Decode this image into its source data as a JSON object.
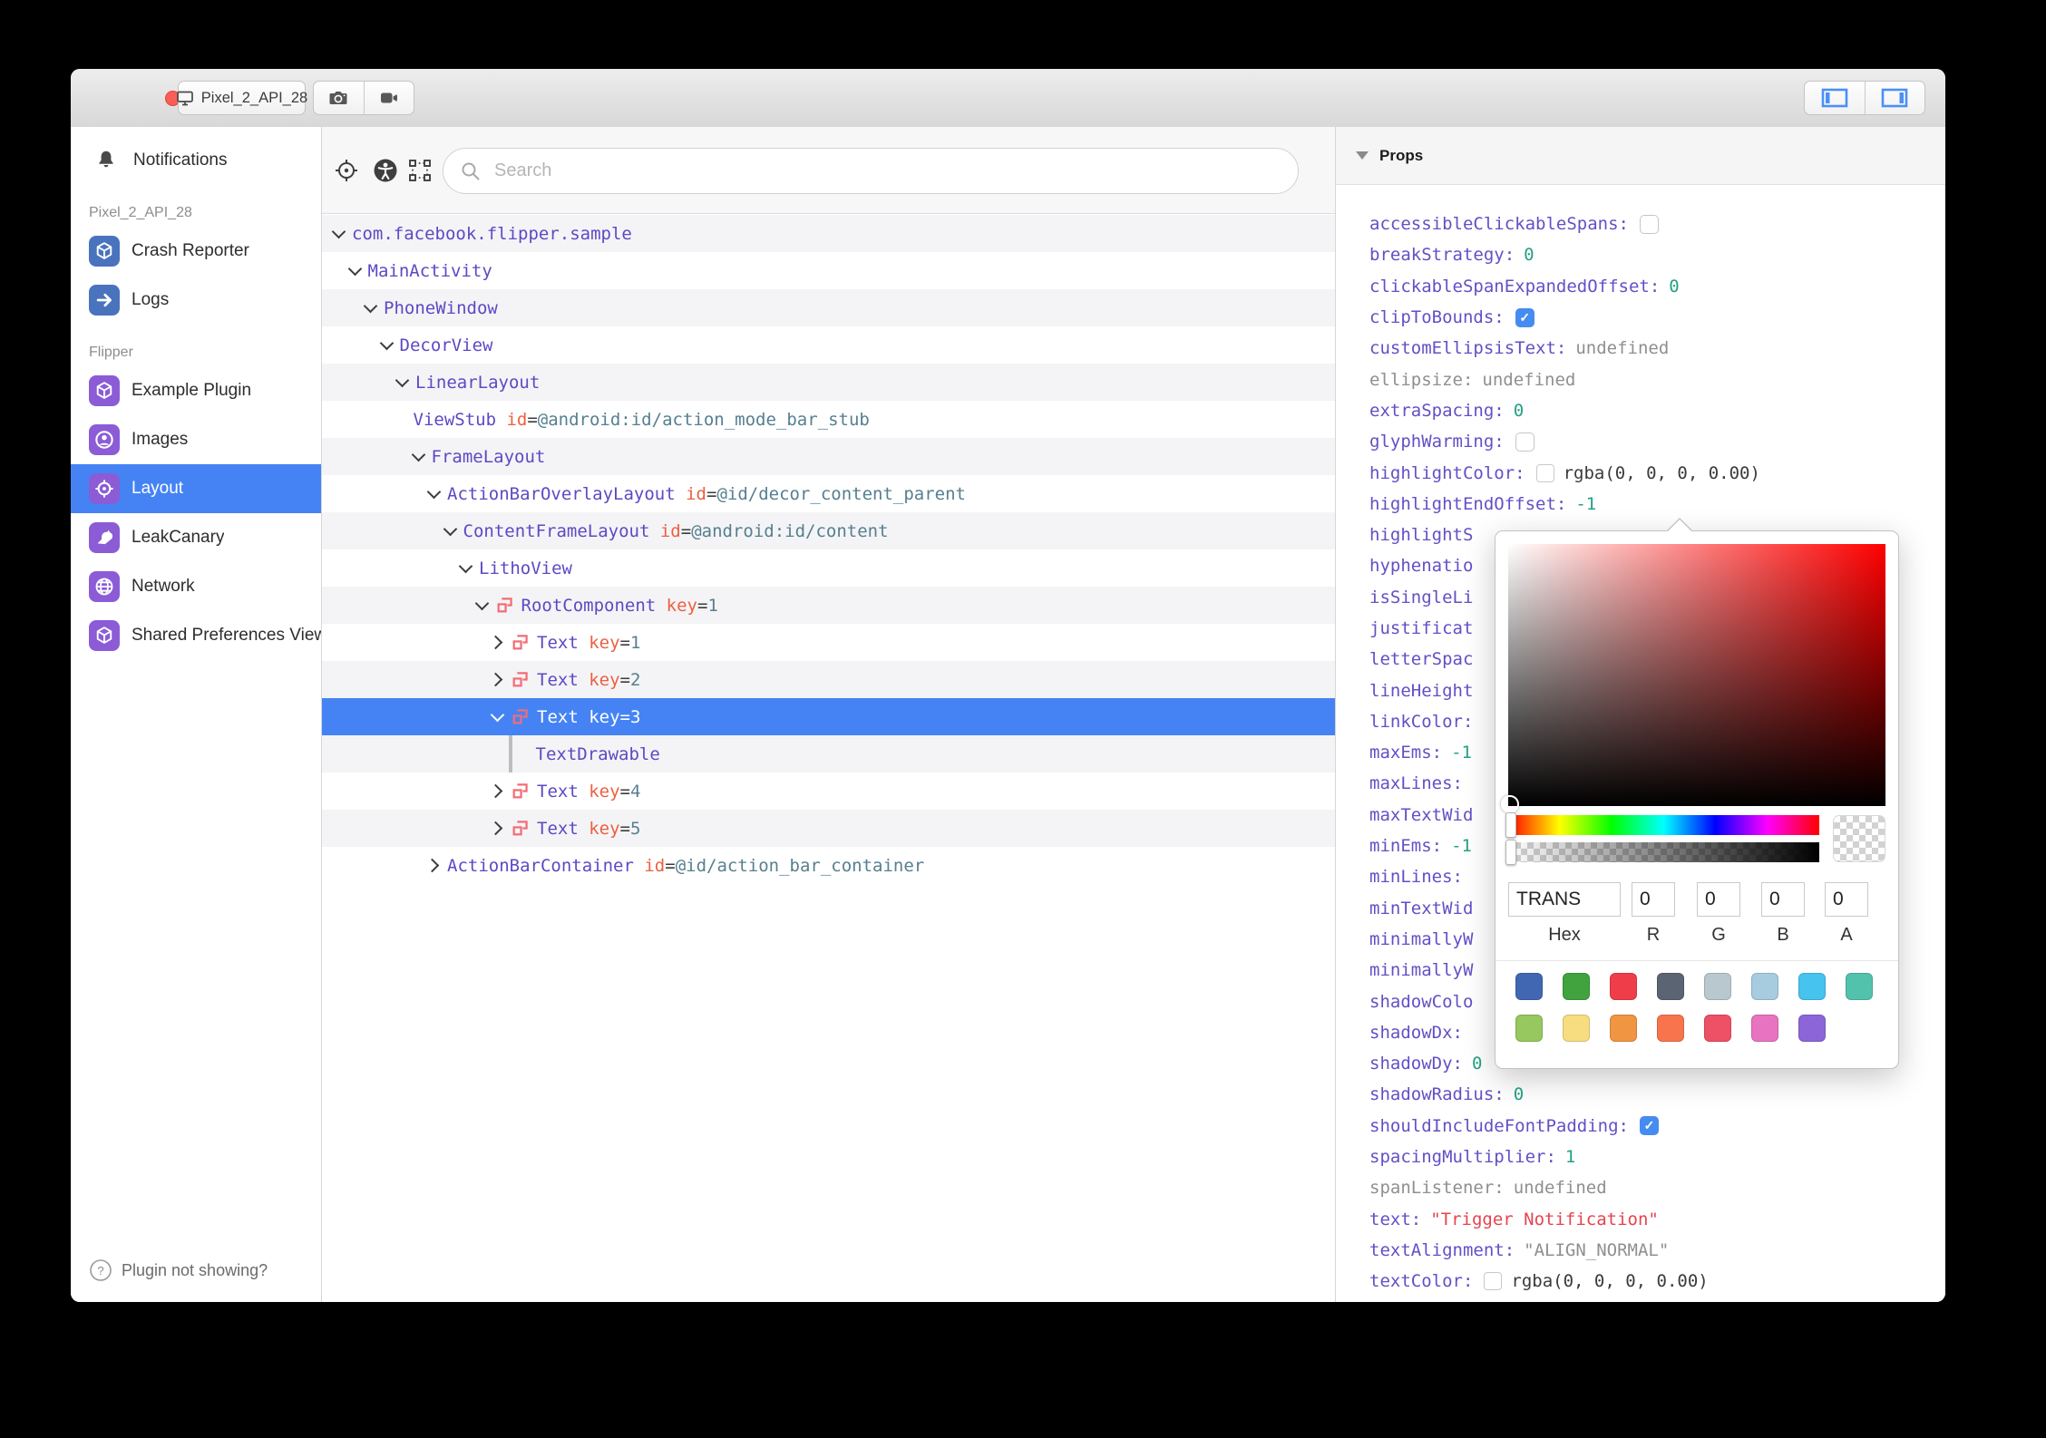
{
  "titlebar": {
    "device_button": "Pixel_2_API_28",
    "traffic_lights": {
      "close": "#f95f57",
      "minimize": "#fbbd2e",
      "zoom": "#32c842"
    }
  },
  "sidebar": {
    "notifications_label": "Notifications",
    "sections": [
      {
        "label": "Pixel_2_API_28",
        "items": [
          {
            "label": "Crash Reporter",
            "icon": "cube",
            "color": "#4a73bd"
          },
          {
            "label": "Logs",
            "icon": "arrow-right",
            "color": "#4a73bd"
          }
        ]
      },
      {
        "label": "Flipper",
        "items": [
          {
            "label": "Example Plugin",
            "icon": "cube",
            "color": "#8b5cd6"
          },
          {
            "label": "Images",
            "icon": "user-circle",
            "color": "#8b5cd6"
          },
          {
            "label": "Layout",
            "icon": "target",
            "color": "#8b5cd6",
            "selected": true
          },
          {
            "label": "LeakCanary",
            "icon": "bird",
            "color": "#8b5cd6"
          },
          {
            "label": "Network",
            "icon": "globe",
            "color": "#8b5cd6"
          },
          {
            "label": "Shared Preferences Viewer",
            "icon": "cube",
            "color": "#8b5cd6"
          }
        ]
      }
    ],
    "footer_label": "Plugin not showing?"
  },
  "toolbar": {
    "search_placeholder": "Search"
  },
  "tree": {
    "selected_color": "#4583f5",
    "rows": [
      {
        "name": "com.facebook.flipper.sample",
        "depth": 0,
        "chevron": "expanded"
      },
      {
        "name": "MainActivity",
        "depth": 1,
        "chevron": "expanded"
      },
      {
        "name": "PhoneWindow",
        "depth": 2,
        "chevron": "expanded"
      },
      {
        "name": "DecorView",
        "depth": 3,
        "chevron": "expanded"
      },
      {
        "name": "LinearLayout",
        "depth": 4,
        "chevron": "expanded"
      },
      {
        "name": "ViewStub",
        "depth": 5,
        "chevron": "none",
        "attrs": [
          {
            "k": "id",
            "v": "@android:id/action_mode_bar_stub"
          }
        ]
      },
      {
        "name": "FrameLayout",
        "depth": 5,
        "chevron": "expanded"
      },
      {
        "name": "ActionBarOverlayLayout",
        "depth": 6,
        "chevron": "expanded",
        "attrs": [
          {
            "k": "id",
            "v": "@id/decor_content_parent"
          }
        ]
      },
      {
        "name": "ContentFrameLayout",
        "depth": 7,
        "chevron": "expanded",
        "attrs": [
          {
            "k": "id",
            "v": "@android:id/content"
          }
        ]
      },
      {
        "name": "LithoView",
        "depth": 8,
        "chevron": "expanded"
      },
      {
        "name": "RootComponent",
        "depth": 9,
        "chevron": "expanded",
        "litho": true,
        "attrs": [
          {
            "k": "key",
            "v": "1"
          }
        ]
      },
      {
        "name": "Text",
        "depth": 10,
        "chevron": "collapsed",
        "litho": true,
        "attrs": [
          {
            "k": "key",
            "v": "1"
          }
        ]
      },
      {
        "name": "Text",
        "depth": 10,
        "chevron": "collapsed",
        "litho": true,
        "attrs": [
          {
            "k": "key",
            "v": "2"
          }
        ]
      },
      {
        "name": "Text",
        "depth": 10,
        "chevron": "expanded",
        "litho": true,
        "selected": true,
        "attrs": [
          {
            "k": "key",
            "v": "3"
          }
        ]
      },
      {
        "name": "TextDrawable",
        "depth": 11,
        "chevron": "none",
        "guide": true
      },
      {
        "name": "Text",
        "depth": 10,
        "chevron": "collapsed",
        "litho": true,
        "attrs": [
          {
            "k": "key",
            "v": "4"
          }
        ]
      },
      {
        "name": "Text",
        "depth": 10,
        "chevron": "collapsed",
        "litho": true,
        "attrs": [
          {
            "k": "key",
            "v": "5"
          }
        ]
      },
      {
        "name": "ActionBarContainer",
        "depth": 6,
        "chevron": "collapsed",
        "attrs": [
          {
            "k": "id",
            "v": "@id/action_bar_container"
          }
        ]
      }
    ]
  },
  "props": {
    "title": "Props",
    "rows": [
      {
        "name": "accessibleClickableSpans",
        "type": "check_off"
      },
      {
        "name": "breakStrategy",
        "type": "num",
        "value": "0"
      },
      {
        "name": "clickableSpanExpandedOffset",
        "type": "num",
        "value": "0"
      },
      {
        "name": "clipToBounds",
        "type": "check_on"
      },
      {
        "name": "customEllipsisText",
        "type": "undef",
        "value": "undefined"
      },
      {
        "name": "ellipsize",
        "gray": true,
        "type": "undef",
        "value": "undefined"
      },
      {
        "name": "extraSpacing",
        "type": "num",
        "value": "0"
      },
      {
        "name": "glyphWarming",
        "type": "check_off"
      },
      {
        "name": "highlightColor",
        "type": "color",
        "value": "rgba(0, 0, 0, 0.00)"
      },
      {
        "name": "highlightEndOffset",
        "type": "num",
        "value": "-1"
      },
      {
        "name": "highlightS",
        "colon": false,
        "type": "none"
      },
      {
        "name": "hyphenatio",
        "colon": false,
        "type": "none"
      },
      {
        "name": "isSingleLi",
        "colon": false,
        "type": "none"
      },
      {
        "name": "justificat",
        "colon": false,
        "type": "none"
      },
      {
        "name": "letterSpac",
        "colon": false,
        "type": "none"
      },
      {
        "name": "lineHeight",
        "colon": false,
        "type": "none"
      },
      {
        "name": "linkColor",
        "type": "none"
      },
      {
        "name": "maxEms",
        "type": "num",
        "value": "-1"
      },
      {
        "name": "maxLines",
        "type": "none"
      },
      {
        "name": "maxTextWid",
        "colon": false,
        "type": "none"
      },
      {
        "name": "minEms",
        "type": "num",
        "value": "-1"
      },
      {
        "name": "minLines",
        "type": "none"
      },
      {
        "name": "minTextWid",
        "colon": false,
        "type": "none"
      },
      {
        "name": "minimallyW",
        "colon": false,
        "type": "none"
      },
      {
        "name": "minimallyW",
        "colon": false,
        "type": "none"
      },
      {
        "name": "shadowColo",
        "colon": false,
        "type": "none"
      },
      {
        "name": "shadowDx",
        "type": "none"
      },
      {
        "name": "shadowDy",
        "type": "num",
        "value": "0"
      },
      {
        "name": "shadowRadius",
        "type": "num",
        "value": "0"
      },
      {
        "name": "shouldIncludeFontPadding",
        "type": "check_on"
      },
      {
        "name": "spacingMultiplier",
        "type": "num",
        "value": "1"
      },
      {
        "name": "spanListener",
        "gray": true,
        "type": "undef",
        "value": "undefined"
      },
      {
        "name": "text",
        "type": "str",
        "value": "\"Trigger Notification\""
      },
      {
        "name": "textAlignment",
        "type": "strgray",
        "value": "\"ALIGN_NORMAL\""
      },
      {
        "name": "textColor",
        "type": "color",
        "value": "rgba(0, 0, 0, 0.00)"
      }
    ]
  },
  "picker": {
    "hex": "TRANS",
    "r": "0",
    "g": "0",
    "b": "0",
    "a": "0",
    "labels": {
      "hex": "Hex",
      "r": "R",
      "g": "G",
      "b": "B",
      "a": "A"
    },
    "swatches_row1": [
      "#4267b2",
      "#41a33e",
      "#ef3e4a",
      "#5a6472",
      "#b9c8cf",
      "#a7cce0",
      "#46c3ef",
      "#52c2ac"
    ],
    "swatches_row2": [
      "#96c85f",
      "#f8dc80",
      "#f09643",
      "#f7744d",
      "#ee5066",
      "#e873c0",
      "#8c66d9"
    ]
  }
}
